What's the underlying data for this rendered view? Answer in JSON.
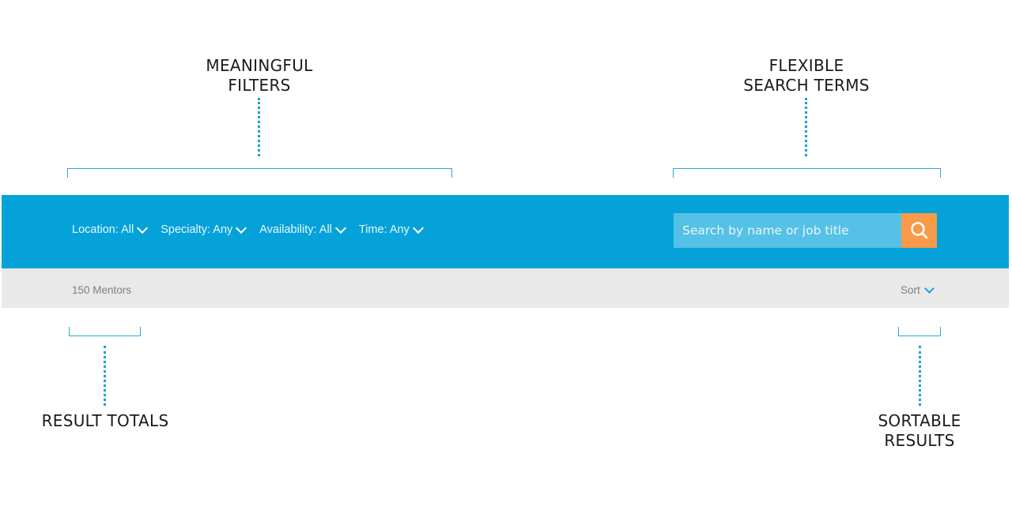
{
  "annotations": {
    "filters_line1": "MEANINGFUL",
    "filters_line2": "FILTERS",
    "search_line1": "FLEXIBLE",
    "search_line2": "SEARCH TERMS",
    "totals_line1": "RESULT TOTALS",
    "sort_line1": "SORTABLE",
    "sort_line2": "RESULTS"
  },
  "filter_bar": {
    "filters": [
      {
        "label": "Location: All"
      },
      {
        "label": "Specialty: Any"
      },
      {
        "label": "Availability: All"
      },
      {
        "label": "Time: Any"
      }
    ],
    "search": {
      "placeholder": "Search by name or job title",
      "value": ""
    },
    "icons": {
      "dropdown": "chevron-down-icon",
      "search": "search-icon"
    }
  },
  "results_bar": {
    "total": "150 Mentors",
    "sort_label": "Sort"
  },
  "colors": {
    "accent_blue": "#04a2d9",
    "search_field": "#55c1e6",
    "search_button": "#f99a48",
    "results_bar": "#e9e9e9",
    "annotation_line": "#13a1dc"
  }
}
